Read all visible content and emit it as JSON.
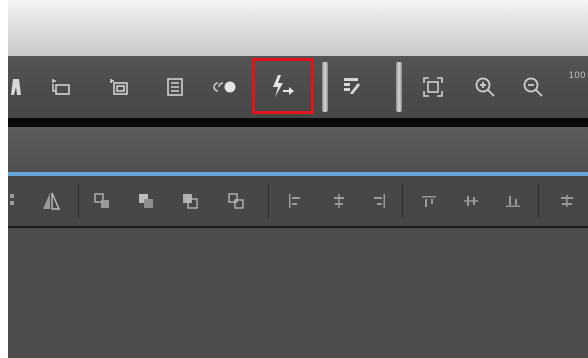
{
  "toolbar": {
    "selected_tool": "lightning-arrow-icon",
    "icons": [
      "person-icon",
      "layers-icon",
      "layer-copy-icon",
      "list-icon",
      "toggle-icon",
      "lightning-arrow-icon",
      "pen-table-icon",
      "fit-screen-icon",
      "zoom-in-icon",
      "zoom-out-icon",
      "zoom-100-icon"
    ],
    "zoom_label": "100"
  },
  "align_toolbar": {
    "icons": [
      "flip-icon",
      "mirror-icon",
      "bring-forward-icon",
      "bring-to-front-icon",
      "send-to-back-icon",
      "send-backward-icon",
      "align-left-icon",
      "align-center-icon",
      "align-right-icon",
      "align-top-icon",
      "align-middle-icon",
      "align-bottom-icon",
      "distribute-icon"
    ]
  },
  "colors": {
    "highlight": "#e0141b",
    "accent_line": "#6aa7d8"
  }
}
